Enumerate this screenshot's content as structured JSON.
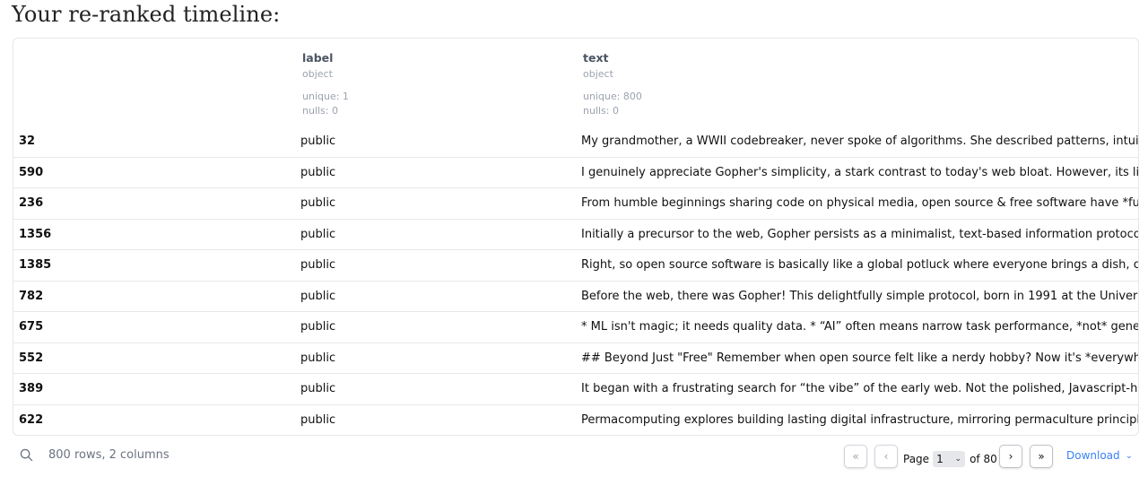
{
  "heading": "Your re-ranked timeline:",
  "columns": {
    "label": {
      "name": "label",
      "dtype": "object",
      "unique": "unique: 1",
      "nulls": "nulls: 0"
    },
    "text": {
      "name": "text",
      "dtype": "object",
      "unique": "unique: 800",
      "nulls": "nulls: 0"
    }
  },
  "rows": [
    {
      "index": "32",
      "label": "public",
      "text": "My grandmother, a WWII codebreaker, never spoke of algorithms. She described patterns, intuition, "
    },
    {
      "index": "590",
      "label": "public",
      "text": "I genuinely appreciate Gopher's simplicity, a stark contrast to today's web bloat. However, its limitat"
    },
    {
      "index": "236",
      "label": "public",
      "text": "From humble beginnings sharing code on physical media, open source & free software have *fuelec"
    },
    {
      "index": "1356",
      "label": "public",
      "text": "Initially a precursor to the web, Gopher persists as a minimalist, text-based information protocol, ex"
    },
    {
      "index": "1385",
      "label": "public",
      "text": "Right, so open source software is basically like a global potluck where everyone brings a dish, critiq"
    },
    {
      "index": "782",
      "label": "public",
      "text": "Before the web, there was Gopher! This delightfully simple protocol, born in 1991 at the University"
    },
    {
      "index": "675",
      "label": "public",
      "text": "* ML isn't magic; it needs quality data.  * “AI” often means narrow task performance, *not* general in"
    },
    {
      "index": "552",
      "label": "public",
      "text": "## Beyond Just \"Free\"  Remember when open source felt like a nerdy hobby? Now it's *everywhere*"
    },
    {
      "index": "389",
      "label": "public",
      "text": "It began with a frustrating search for “the vibe” of the early web. Not the polished, Javascript-heavy"
    },
    {
      "index": "622",
      "label": "public",
      "text": "Permacomputing explores building lasting digital infrastructure, mirroring permaculture principles."
    }
  ],
  "footer": {
    "summary": "800 rows, 2 columns",
    "page_label": "Page",
    "page_value": "1",
    "of_label": "of 80",
    "download_label": "Download",
    "first_icon": "double-chevron-left-icon",
    "prev_icon": "chevron-left-icon",
    "next_icon": "chevron-right-icon",
    "last_icon": "double-chevron-right-icon"
  },
  "colors": {
    "accent": "#3b82f6",
    "muted": "#9ca3af"
  }
}
